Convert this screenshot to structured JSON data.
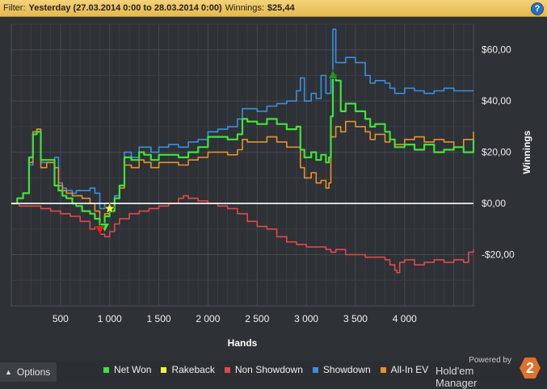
{
  "filter": {
    "label": "Filter:",
    "period": "Yesterday (27.03.2014 0:00 to 28.03.2014 0:00)",
    "winnings_label": "Winnings:",
    "winnings_value": "$25,44",
    "help_symbol": "?"
  },
  "options_label": "Options",
  "options_icon": "chevron-up-icon",
  "brand": {
    "powered_by": "Powered by",
    "name": "Hold'em Manager",
    "logo_text": "2"
  },
  "colors": {
    "net_won": "#3fe43a",
    "rakeback": "#f2f23a",
    "non_showdown": "#e04a4a",
    "showdown": "#3c8fe0",
    "all_in_ev": "#e8912c",
    "zero_line": "#ffffff",
    "background": "#2e3136",
    "grid": "#3d4046"
  },
  "chart_data": {
    "type": "line",
    "xlabel": "Hands",
    "ylabel": "Winnings",
    "xlim": [
      0,
      4700
    ],
    "ylim": [
      -40,
      70
    ],
    "x_ticks": [
      {
        "v": 500,
        "label": "500"
      },
      {
        "v": 1000,
        "label": "1 000"
      },
      {
        "v": 1500,
        "label": "1 500"
      },
      {
        "v": 2000,
        "label": "2 000"
      },
      {
        "v": 2500,
        "label": "2 500"
      },
      {
        "v": 3000,
        "label": "3 000"
      },
      {
        "v": 3500,
        "label": "3 500"
      },
      {
        "v": 4000,
        "label": "4 000"
      }
    ],
    "y_ticks": [
      {
        "v": 60,
        "label": "$60,00"
      },
      {
        "v": 40,
        "label": "$40,00"
      },
      {
        "v": 20,
        "label": "$20,00"
      },
      {
        "v": 0,
        "label": "$0,00"
      },
      {
        "v": -20,
        "label": "-$20,00"
      }
    ],
    "grid": true,
    "legend_position": "bottom",
    "series": [
      {
        "name": "Showdown",
        "color_key": "showdown",
        "points": [
          [
            0,
            0
          ],
          [
            60,
            2
          ],
          [
            120,
            4
          ],
          [
            180,
            15
          ],
          [
            220,
            27
          ],
          [
            260,
            29
          ],
          [
            300,
            16
          ],
          [
            360,
            16
          ],
          [
            440,
            18
          ],
          [
            480,
            8
          ],
          [
            520,
            6
          ],
          [
            560,
            5
          ],
          [
            620,
            4
          ],
          [
            660,
            5
          ],
          [
            720,
            5
          ],
          [
            800,
            6
          ],
          [
            850,
            4
          ],
          [
            900,
            -2
          ],
          [
            950,
            0
          ],
          [
            1000,
            0
          ],
          [
            1050,
            3
          ],
          [
            1100,
            7
          ],
          [
            1150,
            20
          ],
          [
            1220,
            18
          ],
          [
            1300,
            22
          ],
          [
            1350,
            22
          ],
          [
            1420,
            20
          ],
          [
            1500,
            22
          ],
          [
            1600,
            23
          ],
          [
            1700,
            22
          ],
          [
            1800,
            24
          ],
          [
            1900,
            25
          ],
          [
            2000,
            28
          ],
          [
            2100,
            29
          ],
          [
            2200,
            30
          ],
          [
            2300,
            33
          ],
          [
            2350,
            37
          ],
          [
            2400,
            37
          ],
          [
            2500,
            36
          ],
          [
            2600,
            38
          ],
          [
            2700,
            39
          ],
          [
            2800,
            40
          ],
          [
            2900,
            44
          ],
          [
            2940,
            49
          ],
          [
            2980,
            40
          ],
          [
            3050,
            43
          ],
          [
            3100,
            41
          ],
          [
            3150,
            50
          ],
          [
            3200,
            43
          ],
          [
            3250,
            50
          ],
          [
            3270,
            68
          ],
          [
            3300,
            55
          ],
          [
            3350,
            55
          ],
          [
            3400,
            57
          ],
          [
            3500,
            55
          ],
          [
            3600,
            50
          ],
          [
            3650,
            47
          ],
          [
            3700,
            48
          ],
          [
            3800,
            47
          ],
          [
            3850,
            45
          ],
          [
            3900,
            43
          ],
          [
            4000,
            45
          ],
          [
            4100,
            44
          ],
          [
            4200,
            43
          ],
          [
            4300,
            44
          ],
          [
            4400,
            45
          ],
          [
            4500,
            44
          ],
          [
            4700,
            44
          ]
        ]
      },
      {
        "name": "All-In EV",
        "color_key": "all_in_ev",
        "points": [
          [
            0,
            0
          ],
          [
            60,
            2
          ],
          [
            120,
            4
          ],
          [
            180,
            16
          ],
          [
            220,
            28
          ],
          [
            260,
            29
          ],
          [
            300,
            14
          ],
          [
            360,
            16
          ],
          [
            440,
            14
          ],
          [
            480,
            7
          ],
          [
            520,
            5
          ],
          [
            560,
            4
          ],
          [
            620,
            3
          ],
          [
            660,
            3
          ],
          [
            720,
            2
          ],
          [
            800,
            0
          ],
          [
            850,
            -3
          ],
          [
            900,
            -8
          ],
          [
            950,
            -4
          ],
          [
            1000,
            -3
          ],
          [
            1050,
            2
          ],
          [
            1100,
            6
          ],
          [
            1150,
            15
          ],
          [
            1220,
            14
          ],
          [
            1300,
            17
          ],
          [
            1350,
            16
          ],
          [
            1420,
            14
          ],
          [
            1500,
            16
          ],
          [
            1600,
            16
          ],
          [
            1700,
            15
          ],
          [
            1800,
            17
          ],
          [
            1900,
            18
          ],
          [
            2000,
            20
          ],
          [
            2100,
            20
          ],
          [
            2200,
            19
          ],
          [
            2300,
            21
          ],
          [
            2350,
            25
          ],
          [
            2400,
            24
          ],
          [
            2500,
            24
          ],
          [
            2600,
            26
          ],
          [
            2700,
            24
          ],
          [
            2800,
            22
          ],
          [
            2900,
            22
          ],
          [
            2940,
            14
          ],
          [
            2980,
            10
          ],
          [
            3050,
            12
          ],
          [
            3100,
            8
          ],
          [
            3150,
            9
          ],
          [
            3200,
            6
          ],
          [
            3230,
            8
          ],
          [
            3250,
            26
          ],
          [
            3300,
            30
          ],
          [
            3350,
            28
          ],
          [
            3400,
            32
          ],
          [
            3500,
            30
          ],
          [
            3600,
            28
          ],
          [
            3650,
            25
          ],
          [
            3700,
            27
          ],
          [
            3800,
            24
          ],
          [
            3850,
            25
          ],
          [
            3900,
            23
          ],
          [
            4000,
            25
          ],
          [
            4100,
            26
          ],
          [
            4200,
            24
          ],
          [
            4300,
            25
          ],
          [
            4400,
            24
          ],
          [
            4500,
            22
          ],
          [
            4600,
            25
          ],
          [
            4700,
            28
          ]
        ]
      },
      {
        "name": "Net Won",
        "color_key": "net_won",
        "points": [
          [
            0,
            0
          ],
          [
            60,
            2
          ],
          [
            120,
            4
          ],
          [
            180,
            18
          ],
          [
            220,
            27
          ],
          [
            260,
            28
          ],
          [
            300,
            17
          ],
          [
            360,
            17
          ],
          [
            440,
            7
          ],
          [
            480,
            5
          ],
          [
            520,
            3
          ],
          [
            560,
            2
          ],
          [
            620,
            0
          ],
          [
            660,
            -1
          ],
          [
            720,
            -3
          ],
          [
            800,
            -4
          ],
          [
            850,
            -6
          ],
          [
            900,
            -9
          ],
          [
            950,
            -5
          ],
          [
            1000,
            -3
          ],
          [
            1050,
            2
          ],
          [
            1100,
            7
          ],
          [
            1150,
            18
          ],
          [
            1220,
            17
          ],
          [
            1300,
            20
          ],
          [
            1350,
            19
          ],
          [
            1420,
            17
          ],
          [
            1500,
            19
          ],
          [
            1600,
            19
          ],
          [
            1700,
            18
          ],
          [
            1800,
            20
          ],
          [
            1900,
            22
          ],
          [
            2000,
            26
          ],
          [
            2100,
            26
          ],
          [
            2200,
            25
          ],
          [
            2300,
            27
          ],
          [
            2350,
            33
          ],
          [
            2400,
            32
          ],
          [
            2500,
            31
          ],
          [
            2600,
            33
          ],
          [
            2700,
            31
          ],
          [
            2800,
            29
          ],
          [
            2900,
            30
          ],
          [
            2940,
            21
          ],
          [
            2980,
            18
          ],
          [
            3050,
            20
          ],
          [
            3100,
            17
          ],
          [
            3150,
            19
          ],
          [
            3200,
            16
          ],
          [
            3230,
            18
          ],
          [
            3250,
            34
          ],
          [
            3270,
            50
          ],
          [
            3300,
            48
          ],
          [
            3350,
            36
          ],
          [
            3400,
            39
          ],
          [
            3500,
            36
          ],
          [
            3600,
            33
          ],
          [
            3650,
            30
          ],
          [
            3700,
            31
          ],
          [
            3800,
            28
          ],
          [
            3850,
            25
          ],
          [
            3900,
            22
          ],
          [
            4000,
            23
          ],
          [
            4100,
            21
          ],
          [
            4200,
            23
          ],
          [
            4300,
            20
          ],
          [
            4400,
            21
          ],
          [
            4500,
            22
          ],
          [
            4600,
            20
          ],
          [
            4700,
            25
          ]
        ]
      },
      {
        "name": "Non Showdown",
        "color_key": "non_showdown",
        "points": [
          [
            0,
            0
          ],
          [
            80,
            -1
          ],
          [
            200,
            -1
          ],
          [
            300,
            -2
          ],
          [
            400,
            -3
          ],
          [
            500,
            -4
          ],
          [
            600,
            -5
          ],
          [
            700,
            -7
          ],
          [
            800,
            -10
          ],
          [
            850,
            -9
          ],
          [
            900,
            -12
          ],
          [
            950,
            -13
          ],
          [
            1000,
            -11
          ],
          [
            1050,
            -8
          ],
          [
            1100,
            -6
          ],
          [
            1200,
            -4
          ],
          [
            1300,
            -3
          ],
          [
            1400,
            -2
          ],
          [
            1500,
            -1
          ],
          [
            1600,
            0
          ],
          [
            1700,
            2
          ],
          [
            1750,
            3
          ],
          [
            1800,
            2
          ],
          [
            1900,
            1
          ],
          [
            2000,
            0
          ],
          [
            2100,
            -1
          ],
          [
            2200,
            -2
          ],
          [
            2300,
            -4
          ],
          [
            2400,
            -7
          ],
          [
            2500,
            -9
          ],
          [
            2600,
            -10
          ],
          [
            2700,
            -13
          ],
          [
            2800,
            -15
          ],
          [
            2900,
            -16
          ],
          [
            3000,
            -17
          ],
          [
            3100,
            -17
          ],
          [
            3200,
            -18
          ],
          [
            3250,
            -19
          ],
          [
            3300,
            -18
          ],
          [
            3400,
            -20
          ],
          [
            3500,
            -20
          ],
          [
            3600,
            -21
          ],
          [
            3700,
            -21
          ],
          [
            3800,
            -22
          ],
          [
            3850,
            -24
          ],
          [
            3900,
            -26
          ],
          [
            3920,
            -27
          ],
          [
            3950,
            -23
          ],
          [
            4000,
            -22
          ],
          [
            4100,
            -24
          ],
          [
            4200,
            -23
          ],
          [
            4300,
            -22
          ],
          [
            4400,
            -23
          ],
          [
            4500,
            -22
          ],
          [
            4600,
            -23
          ],
          [
            4650,
            -19
          ],
          [
            4700,
            -18
          ]
        ]
      }
    ],
    "markers": [
      {
        "series": "Rakeback",
        "color_key": "rakeback",
        "shape": "star",
        "x": 1000,
        "y": -2
      },
      {
        "series": "Net Won",
        "color_key": "net_won",
        "shape": "triangle-down",
        "x": 950,
        "y": -9
      },
      {
        "series": "Non Showdown",
        "color_key": "non_showdown",
        "shape": "triangle-down",
        "x": 900,
        "y": -10
      },
      {
        "series": "Net Won",
        "color_key": "net_won",
        "shape": "triangle-up",
        "x": 3270,
        "y": 50
      }
    ],
    "legend": [
      {
        "label": "Net Won",
        "color_key": "net_won"
      },
      {
        "label": "Rakeback",
        "color_key": "rakeback"
      },
      {
        "label": "Non Showdown",
        "color_key": "non_showdown"
      },
      {
        "label": "Showdown",
        "color_key": "showdown"
      },
      {
        "label": "All-In EV",
        "color_key": "all_in_ev"
      }
    ]
  }
}
